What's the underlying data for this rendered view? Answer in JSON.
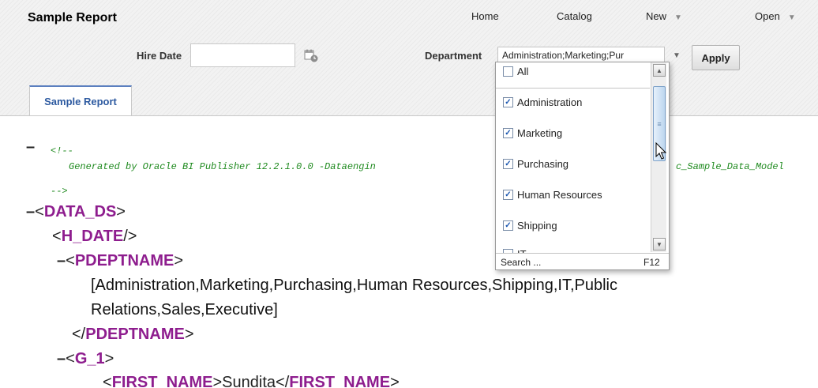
{
  "header": {
    "title": "Sample Report"
  },
  "nav": {
    "home": "Home",
    "catalog": "Catalog",
    "new": "New",
    "open": "Open",
    "arrow": "▼"
  },
  "params": {
    "hire_date_label": "Hire Date",
    "hire_date_value": "",
    "department_label": "Department",
    "department_value": "Administration;Marketing;Pur",
    "apply_label": "Apply"
  },
  "tabs": [
    {
      "label": "Sample Report",
      "active": true
    }
  ],
  "dropdown": {
    "items": [
      {
        "label": "All",
        "checked": false
      },
      {
        "label": "Administration",
        "checked": true
      },
      {
        "label": "Marketing",
        "checked": true
      },
      {
        "label": "Purchasing",
        "checked": true
      },
      {
        "label": "Human Resources",
        "checked": true
      },
      {
        "label": "Shipping",
        "checked": true
      },
      {
        "label": "IT",
        "checked": false
      }
    ],
    "check_glyph": "✓",
    "scroll_up": "▲",
    "scroll_down": "▼",
    "scroll_grip": "≡",
    "search_label": "Search ...",
    "shortcut": "F12"
  },
  "xml": {
    "comment_open": "<!--",
    "comment_body_1": "Generated by Oracle BI Publisher 12.2.1.0.0 -Dataengin",
    "comment_body_2": "c_Sample_Data_Model",
    "comment_close": "-->",
    "minus": "–",
    "lt": "<",
    "gt": ">",
    "lt_slash": "</",
    "self_close": "/>",
    "data_ds": "DATA_DS",
    "h_date": "H_DATE",
    "pdeptname": "PDEPTNAME",
    "pdeptname_text_1": "[Administration,Marketing,Purchasing,Human Resources,Shipping,IT,Public",
    "pdeptname_text_2": "Relations,Sales,Executive]",
    "g_1": "G_1",
    "first_name": "FIRST_NAME",
    "first_name_value": "Sundita"
  },
  "colors": {
    "tag": "#8e1d8e",
    "comment": "#1f8a1f",
    "tab_text": "#2d5aa0"
  }
}
